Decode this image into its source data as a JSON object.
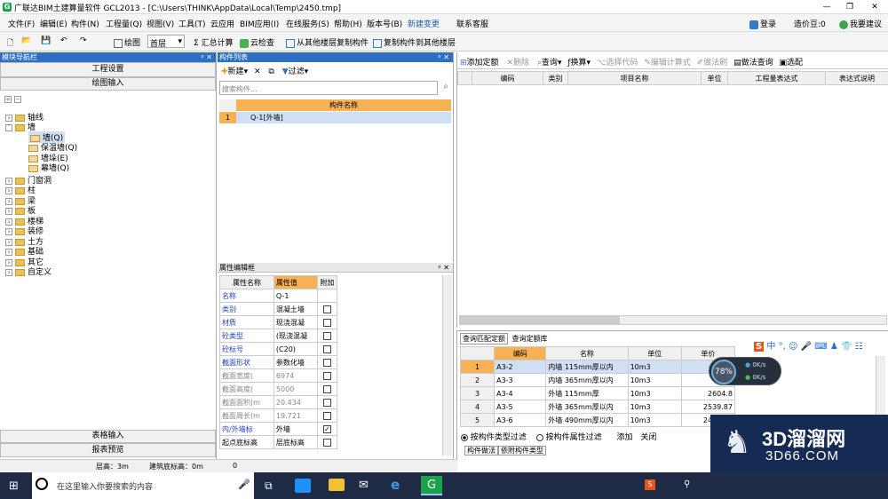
{
  "window": {
    "title": "广联达BIM土建算量软件 GCL2013 - [C:\\Users\\THINK\\AppData\\Local\\Temp\\2450.tmp]",
    "minimize": "—",
    "restore": "❐",
    "close": "✕"
  },
  "menu": {
    "items": [
      "文件(F)",
      "编辑(E)",
      "构件(N)",
      "工程量(Q)",
      "视图(V)",
      "工具(T)",
      "云应用",
      "BIM应用(I)",
      "在线服务(S)",
      "帮助(H)",
      "版本号(B)",
      "新建变更",
      "联系客服"
    ],
    "login": "登录",
    "price": "造价豆:0",
    "suggest": "我要建议"
  },
  "toolbar": {
    "draw": "绘图",
    "floor": "首层",
    "sum": "汇总计算",
    "cloud_check": "云检查",
    "copy_from": "从其他楼层复制构件",
    "copy_to": "复制构件到其他楼层"
  },
  "nav": {
    "title": "模块导航栏",
    "project_settings": "工程设置",
    "drawing_input": "绘图输入",
    "tree": [
      {
        "label": "轴线",
        "level": 0,
        "type": "folder"
      },
      {
        "label": "墙",
        "level": 0,
        "type": "folder"
      },
      {
        "label": "墙(Q)",
        "level": 1,
        "type": "item"
      },
      {
        "label": "保温墙(Q)",
        "level": 1,
        "type": "item"
      },
      {
        "label": "墙垛(E)",
        "level": 1,
        "type": "item"
      },
      {
        "label": "幕墙(Q)",
        "level": 1,
        "type": "item"
      },
      {
        "label": "门窗洞",
        "level": 0,
        "type": "folder"
      },
      {
        "label": "柱",
        "level": 0,
        "type": "folder"
      },
      {
        "label": "梁",
        "level": 0,
        "type": "folder"
      },
      {
        "label": "板",
        "level": 0,
        "type": "folder"
      },
      {
        "label": "楼梯",
        "level": 0,
        "type": "folder"
      },
      {
        "label": "装修",
        "level": 0,
        "type": "folder"
      },
      {
        "label": "土方",
        "level": 0,
        "type": "folder"
      },
      {
        "label": "基础",
        "level": 0,
        "type": "folder"
      },
      {
        "label": "其它",
        "level": 0,
        "type": "folder"
      },
      {
        "label": "自定义",
        "level": 0,
        "type": "folder"
      }
    ],
    "table_input": "表格输入",
    "report_preview": "报表预览"
  },
  "component_list": {
    "title": "构件列表",
    "new": "新建",
    "filter": "过滤",
    "search_placeholder": "搜索构件...",
    "col_name": "构件名称",
    "rows": [
      {
        "no": "1",
        "name": "Q-1[外墙]"
      }
    ]
  },
  "property": {
    "title": "属性编辑框",
    "col_name": "属性名称",
    "col_value": "属性值",
    "col_extra": "附加",
    "rows": [
      {
        "name": "名称",
        "value": "Q-1",
        "check": "none",
        "style": "blue"
      },
      {
        "name": "类别",
        "value": "混凝土墙",
        "check": "off",
        "style": "blue"
      },
      {
        "name": "材质",
        "value": "现浇混凝",
        "check": "off",
        "style": "blue"
      },
      {
        "name": "砼类型",
        "value": "(现浇混凝",
        "check": "off",
        "style": "blue"
      },
      {
        "name": "砼标号",
        "value": "(C20)",
        "check": "off",
        "style": "blue"
      },
      {
        "name": "截面形状",
        "value": "参数化墙",
        "check": "off",
        "style": "blue"
      },
      {
        "name": "截面宽度(",
        "value": "6974",
        "check": "off",
        "style": "gray"
      },
      {
        "name": "截面高度(",
        "value": "5000",
        "check": "off",
        "style": "gray"
      },
      {
        "name": "截面面积(m",
        "value": "20.434",
        "check": "off",
        "style": "gray"
      },
      {
        "name": "截面周长(m",
        "value": "19.721",
        "check": "off",
        "style": "gray"
      },
      {
        "name": "内/外墙标",
        "value": "外墙",
        "check": "on",
        "style": "blue"
      },
      {
        "name": "起点底标高",
        "value": "层底标高",
        "check": "off",
        "style": "black"
      }
    ]
  },
  "quota": {
    "add": "添加定额",
    "delete": "删除",
    "query": "查询",
    "convert": "换算",
    "select_code": "选择代码",
    "edit_formula": "编辑计算式",
    "method_brush": "做法刷",
    "method_query": "做法查询",
    "pick": "选配",
    "cols": [
      "编码",
      "类别",
      "项目名称",
      "单位",
      "工程量表达式",
      "表达式说明"
    ]
  },
  "lookup": {
    "tab1": "查询匹配定额",
    "tab2": "查询定额库",
    "cols": [
      "编码",
      "名称",
      "单位",
      "单价"
    ],
    "rows": [
      {
        "no": "1",
        "code": "A3-2",
        "name": "内墙 115mm厚以内",
        "unit": "10m3",
        "price": "2"
      },
      {
        "no": "2",
        "code": "A3-3",
        "name": "内墙 365mm厚以内",
        "unit": "10m3",
        "price": ""
      },
      {
        "no": "3",
        "code": "A3-4",
        "name": "外墙 115mm厚",
        "unit": "10m3",
        "price": "2604.8"
      },
      {
        "no": "4",
        "code": "A3-5",
        "name": "外墙 365mm厚以内",
        "unit": "10m3",
        "price": "2539.87"
      },
      {
        "no": "5",
        "code": "A3-6",
        "name": "外墙 490mm厚以内",
        "unit": "10m3",
        "price": "2494.76"
      }
    ],
    "filter_type": "按构件类型过滤",
    "filter_prop": "按构件属性过滤",
    "add": "添加",
    "close": "关闭",
    "bottom_tab1": "构件做法",
    "bottom_tab2": "依附构件类型"
  },
  "gauge": {
    "percent": "78%",
    "up": "0K/s",
    "down": "0K/s"
  },
  "status": {
    "floor_height": "层高：3m",
    "base_elev": "建筑底标高：0m",
    "zero": "0"
  },
  "taskbar": {
    "search": "在这里输入你要搜索的内容"
  },
  "watermark": {
    "brand": "3D溜溜网",
    "site": "3D66.COM"
  },
  "colors": {
    "accent": "#2d6fc4",
    "header_orange": "#f7b155",
    "selected": "#cfe0f5"
  }
}
